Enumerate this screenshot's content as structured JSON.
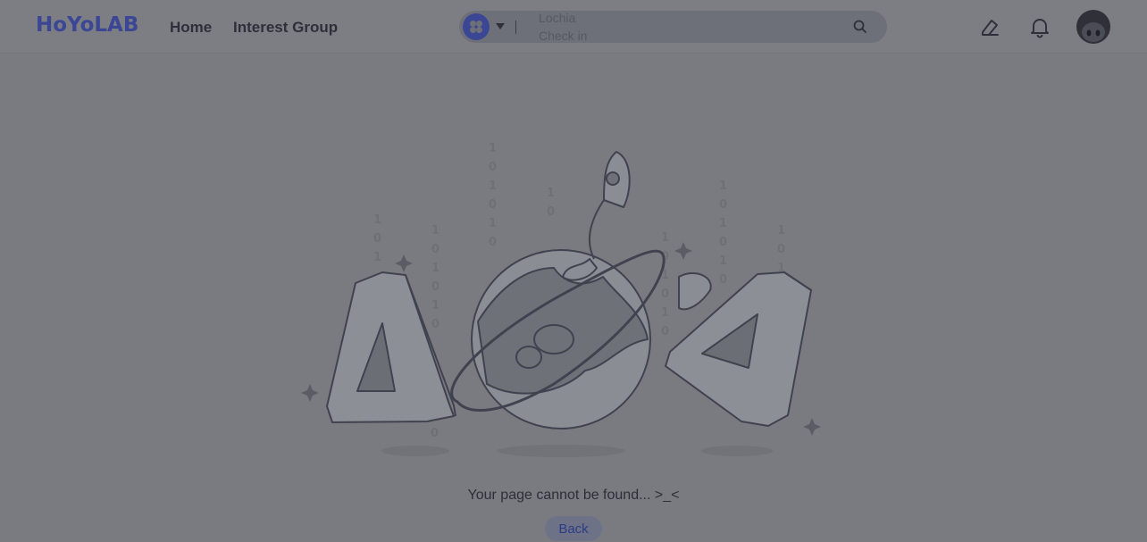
{
  "header": {
    "logo": "HoYoLAB",
    "nav": [
      "Home",
      "Interest Group"
    ],
    "search": {
      "game_icon": "game-grid-icon",
      "rotating_suggestions": [
        "Lochia",
        "Check in"
      ]
    },
    "icons": [
      "edit-icon",
      "bell-icon",
      "avatar"
    ]
  },
  "illustration": {
    "glyphs": [
      "4",
      "4"
    ],
    "binary_columns": [
      "101",
      "1010",
      "101010",
      "10",
      "10101",
      "101010",
      "10",
      "10",
      "10101",
      "010"
    ]
  },
  "message": "Your page cannot be found... >_<",
  "back_label": "Back",
  "colors": {
    "brand": "#3b4694",
    "overlay": "#7a7b80",
    "text": "#2d2e37"
  }
}
